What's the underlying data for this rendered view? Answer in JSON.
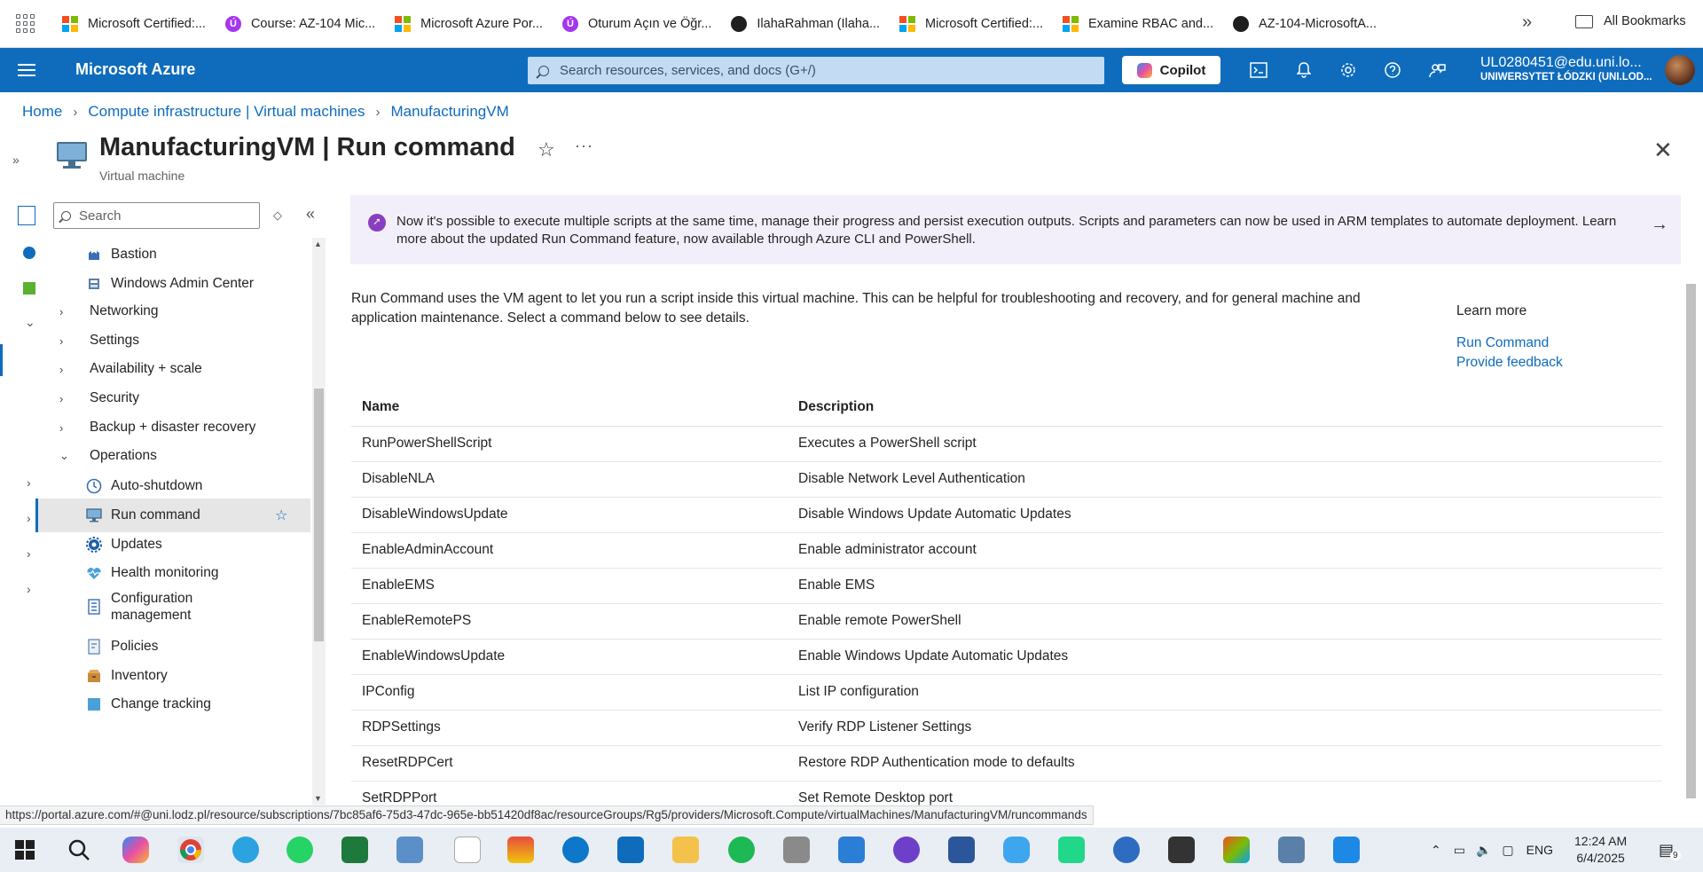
{
  "bookmarks": {
    "items": [
      {
        "label": "Microsoft Certified:...",
        "icon": "microsoft-icon"
      },
      {
        "label": "Course: AZ-104 Mic...",
        "icon": "udemy-icon"
      },
      {
        "label": "Microsoft Azure Por...",
        "icon": "microsoft-icon"
      },
      {
        "label": "Oturum Açın ve Öğr...",
        "icon": "udemy-icon"
      },
      {
        "label": "IlahaRahman (Ilaha...",
        "icon": "github-icon"
      },
      {
        "label": "Microsoft Certified:...",
        "icon": "microsoft-icon"
      },
      {
        "label": "Examine RBAC and...",
        "icon": "microsoft-icon"
      },
      {
        "label": "AZ-104-MicrosoftA...",
        "icon": "github-icon"
      }
    ],
    "more": "»",
    "all_bookmarks": "All Bookmarks"
  },
  "topbar": {
    "brand": "Microsoft Azure",
    "search_placeholder": "Search resources, services, and docs (G+/)",
    "copilot": "Copilot",
    "account_email": "UL0280451@edu.uni.lo...",
    "account_org": "UNIWERSYTET ŁÓDZKI (UNI.LOD..."
  },
  "breadcrumb": [
    "Home",
    "Compute infrastructure | Virtual machines",
    "ManufacturingVM"
  ],
  "blade": {
    "title": "ManufacturingVM | Run command",
    "subtitle": "Virtual machine"
  },
  "menu": {
    "search_placeholder": "Search",
    "items": [
      {
        "label": "Bastion",
        "type": "child",
        "icon": "bastion-icon"
      },
      {
        "label": "Windows Admin Center",
        "type": "child",
        "icon": "admin-center-icon"
      },
      {
        "label": "Networking",
        "type": "group",
        "expanded": false
      },
      {
        "label": "Settings",
        "type": "group",
        "expanded": false
      },
      {
        "label": "Availability + scale",
        "type": "group",
        "expanded": false
      },
      {
        "label": "Security",
        "type": "group",
        "expanded": false
      },
      {
        "label": "Backup + disaster recovery",
        "type": "group",
        "expanded": false
      },
      {
        "label": "Operations",
        "type": "group",
        "expanded": true
      },
      {
        "label": "Auto-shutdown",
        "type": "child",
        "icon": "clock-icon"
      },
      {
        "label": "Run command",
        "type": "child",
        "icon": "run-command-icon",
        "active": true
      },
      {
        "label": "Updates",
        "type": "child",
        "icon": "gear-icon"
      },
      {
        "label": "Health monitoring",
        "type": "child",
        "icon": "heart-icon"
      },
      {
        "label": "Configuration management",
        "type": "child",
        "icon": "config-icon"
      },
      {
        "label": "Policies",
        "type": "child",
        "icon": "policy-icon"
      },
      {
        "label": "Inventory",
        "type": "child",
        "icon": "inventory-icon"
      },
      {
        "label": "Change tracking",
        "type": "child",
        "icon": "change-tracking-icon"
      }
    ]
  },
  "content": {
    "banner": "Now it's possible to execute multiple scripts at the same time, manage their progress and persist execution outputs. Scripts and parameters can now be used in ARM templates to automate deployment. Learn more about the updated Run Command feature, now available through Azure CLI and PowerShell.",
    "intro": "Run Command uses the VM agent to let you run a script inside this virtual machine. This can be helpful for troubleshooting and recovery, and for general machine and application maintenance. Select a command below to see details.",
    "learn_more": {
      "heading": "Learn more",
      "links": [
        "Run Command",
        "Provide feedback"
      ]
    },
    "table": {
      "columns": [
        "Name",
        "Description"
      ],
      "rows": [
        [
          "RunPowerShellScript",
          "Executes a PowerShell script"
        ],
        [
          "DisableNLA",
          "Disable Network Level Authentication"
        ],
        [
          "DisableWindowsUpdate",
          "Disable Windows Update Automatic Updates"
        ],
        [
          "EnableAdminAccount",
          "Enable administrator account"
        ],
        [
          "EnableEMS",
          "Enable EMS"
        ],
        [
          "EnableRemotePS",
          "Enable remote PowerShell"
        ],
        [
          "EnableWindowsUpdate",
          "Enable Windows Update Automatic Updates"
        ],
        [
          "IPConfig",
          "List IP configuration"
        ],
        [
          "RDPSettings",
          "Verify RDP Listener Settings"
        ],
        [
          "ResetRDPCert",
          "Restore RDP Authentication mode to defaults"
        ],
        [
          "SetRDPPort",
          "Set Remote Desktop port"
        ]
      ]
    }
  },
  "status_url": "https://portal.azure.com/#@uni.lodz.pl/resource/subscriptions/7bc85af6-75d3-47dc-965e-bb51420df8ac/resourceGroups/Rg5/providers/Microsoft.Compute/virtualMachines/ManufacturingVM/runcommands",
  "taskbar": {
    "language": "ENG",
    "time": "12:24 AM",
    "date": "6/4/2025",
    "notification_count": "9"
  },
  "colors": {
    "azure_blue": "#0f6cbd",
    "banner_bg": "#f3effa",
    "active_item_bg": "#e6e6e6"
  }
}
